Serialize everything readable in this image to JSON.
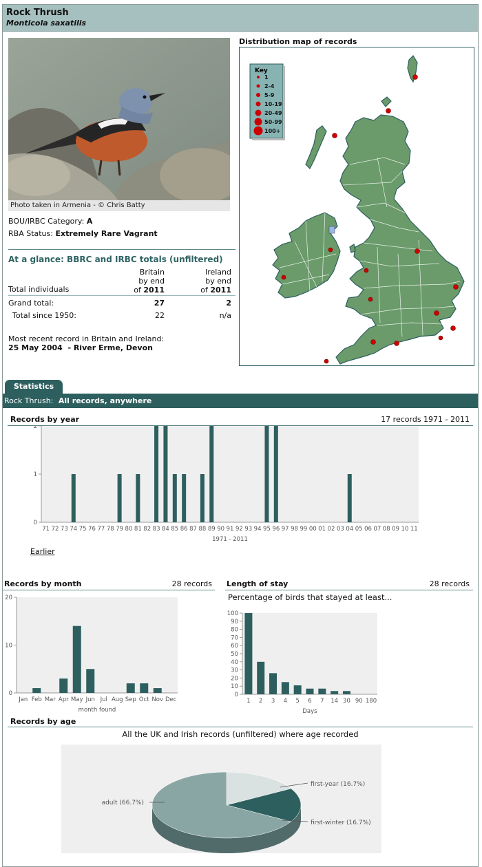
{
  "header": {
    "common_name": "Rock Thrush",
    "scientific_name": "Monticola saxatilis"
  },
  "photo": {
    "caption": "Photo taken in Armenia - © Chris Batty"
  },
  "status": {
    "bou_label": "BOU/IRBC Category: ",
    "bou_value": "A",
    "rba_label": "RBA Status: ",
    "rba_value": "Extremely Rare Vagrant"
  },
  "glance": {
    "title": "At a glance: BBRC and IRBC totals (unfiltered)",
    "col1": [
      "Britain",
      "by end",
      "of ",
      "2011"
    ],
    "col2": [
      "Ireland",
      "by end",
      "of ",
      "2011"
    ],
    "row_label": "Total individuals",
    "grand_label": "Grand total:",
    "grand_britain": "27",
    "grand_ireland": "2",
    "since_label": "Total since 1950:",
    "since_britain": "22",
    "since_ireland": "n/a",
    "recent_label": "Most recent record in Britain and Ireland:",
    "recent_value": "25 May 2004  - River Erme, Devon"
  },
  "map": {
    "title": "Distribution map of records",
    "key_title": "Key",
    "key": [
      "1",
      "2-4",
      "5-9",
      "10-19",
      "20-49",
      "50-99",
      "100+"
    ],
    "colors": {
      "land": "#6b9b6b",
      "sea": "#ffffff",
      "border": "#2d5e5e",
      "dot": "#cc0000"
    }
  },
  "stats": {
    "tab": "Statistics",
    "species": "Rock Thrush:",
    "scope": "All records, anywhere"
  },
  "year_chart": {
    "title": "Records by year",
    "summary": "17 records 1971 - 2011",
    "xlabel": "1971 - 2011",
    "earlier_link": "Earlier"
  },
  "month_chart": {
    "title": "Records by month",
    "summary": "28 records",
    "xlabel": "month found"
  },
  "stay_chart": {
    "title": "Length of stay",
    "summary": "28 records",
    "subtitle": "Percentage of birds that stayed at least...",
    "xlabel": "Days"
  },
  "age_chart": {
    "title": "Records by age",
    "subtitle": "All the UK and Irish records (unfiltered) where age recorded"
  },
  "chart_data": [
    {
      "type": "bar",
      "id": "year",
      "title": "Records by year",
      "xlabel": "1971 - 2011",
      "categories": [
        "71",
        "72",
        "73",
        "74",
        "75",
        "76",
        "77",
        "78",
        "79",
        "80",
        "81",
        "82",
        "83",
        "84",
        "85",
        "86",
        "87",
        "88",
        "89",
        "90",
        "91",
        "92",
        "93",
        "94",
        "95",
        "96",
        "97",
        "98",
        "99",
        "00",
        "01",
        "02",
        "03",
        "04",
        "05",
        "06",
        "07",
        "08",
        "09",
        "10",
        "11"
      ],
      "values": [
        0,
        0,
        0,
        1,
        0,
        0,
        0,
        0,
        1,
        0,
        1,
        0,
        2,
        2,
        1,
        1,
        0,
        1,
        2,
        0,
        0,
        0,
        0,
        0,
        2,
        2,
        0,
        0,
        0,
        0,
        0,
        0,
        0,
        1,
        0,
        0,
        0,
        0,
        0,
        0,
        0
      ],
      "ylim": [
        0,
        2
      ],
      "yticks": [
        0,
        1,
        2
      ],
      "color": "#2e5f5f",
      "background": "#efefef"
    },
    {
      "type": "bar",
      "id": "month",
      "title": "Records by month",
      "xlabel": "month found",
      "categories": [
        "Jan",
        "Feb",
        "Mar",
        "Apr",
        "May",
        "Jun",
        "Jul",
        "Aug",
        "Sep",
        "Oct",
        "Nov",
        "Dec"
      ],
      "values": [
        0,
        1,
        0,
        3,
        14,
        5,
        0,
        0,
        2,
        2,
        1,
        0
      ],
      "ylim": [
        0,
        20
      ],
      "yticks": [
        0,
        10,
        20
      ],
      "color": "#2e5f5f",
      "background": "#efefef"
    },
    {
      "type": "bar",
      "id": "stay",
      "title": "Length of stay",
      "xlabel": "Days",
      "categories": [
        "1",
        "2",
        "3",
        "4",
        "5",
        "6",
        "7",
        "14",
        "30",
        "90",
        "180"
      ],
      "values": [
        100,
        40,
        26,
        15,
        11,
        7,
        7,
        4,
        4,
        0,
        0
      ],
      "ylim": [
        0,
        100
      ],
      "yticks": [
        0,
        10,
        20,
        30,
        40,
        50,
        60,
        70,
        80,
        90,
        100
      ],
      "color": "#2e5f5f",
      "background": "#efefef"
    },
    {
      "type": "pie",
      "id": "age",
      "title": "Records by age",
      "slices": [
        {
          "label": "adult (66.7%)",
          "value": 66.7,
          "color": "#8aa6a4"
        },
        {
          "label": "first-year (16.7%)",
          "value": 16.7,
          "color": "#d9e2e1"
        },
        {
          "label": "first-winter (16.7%)",
          "value": 16.7,
          "color": "#2e5f5f"
        }
      ]
    }
  ]
}
